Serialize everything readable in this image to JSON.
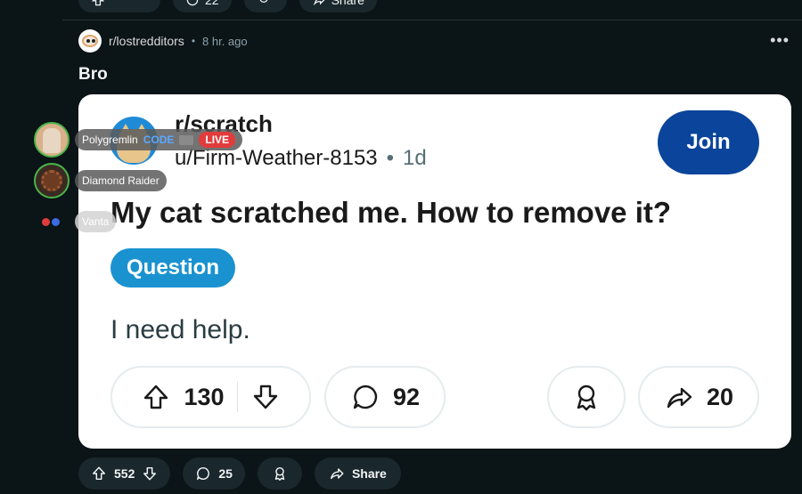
{
  "top_bar": {
    "comments": "22",
    "share": "Share"
  },
  "post": {
    "subreddit": "r/lostredditors",
    "time": "8 hr. ago",
    "title": "Bro",
    "more": "•••"
  },
  "card": {
    "subreddit": "r/scratch",
    "user": "u/Firm-Weather-8153",
    "age": "1d",
    "join_label": "Join",
    "title": "My cat scratched me. How to remove it?",
    "flair": "Question",
    "body": "I need help.",
    "votes": "130",
    "comments": "92",
    "shares": "20"
  },
  "presence": [
    {
      "name": "Polygremlin",
      "badge": "CODE",
      "live": "LIVE"
    },
    {
      "name": "Diamond Raider"
    },
    {
      "name": "Vanta"
    }
  ],
  "bottom_bar": {
    "votes": "552",
    "comments": "25",
    "share": "Share"
  },
  "colors": {
    "background": "#0b1416",
    "pill": "#1a282d",
    "join": "#0a449b",
    "flair": "#1a92d0",
    "live": "#e23b3b",
    "online": "#4ab54a"
  }
}
